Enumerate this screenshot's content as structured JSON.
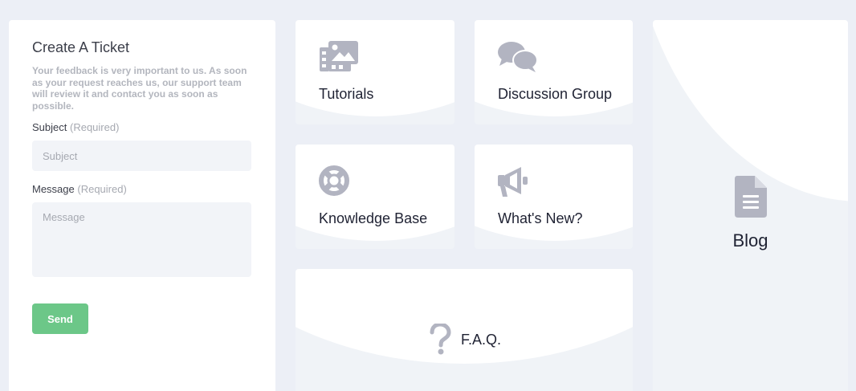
{
  "ticket": {
    "title": "Create A Ticket",
    "description": "Your feedback is very important to us. As soon as your request reaches us, our support team will review it and contact you as soon as possible.",
    "subject_label": "Subject",
    "subject_required": "(Required)",
    "subject_placeholder": "Subject",
    "subject_value": "",
    "message_label": "Message",
    "message_required": "(Required)",
    "message_placeholder": "Message",
    "message_value": "",
    "send_label": "Send"
  },
  "tiles": {
    "tutorials": {
      "label": "Tutorials",
      "icon": "tutorials-gallery-icon"
    },
    "discussion": {
      "label": "Discussion Group",
      "icon": "chat-bubbles-icon"
    },
    "knowledge": {
      "label": "Knowledge Base",
      "icon": "lifebuoy-icon"
    },
    "whatsnew": {
      "label": "What's New?",
      "icon": "megaphone-icon"
    },
    "faq": {
      "label": "F.A.Q.",
      "icon": "question-mark-icon"
    },
    "blog": {
      "label": "Blog",
      "icon": "document-icon"
    }
  },
  "colors": {
    "page_bg": "#eceff6",
    "tile_bg": "#f0f3f7",
    "icon": "#b2b4c1",
    "send_button": "#6cc788",
    "text_dark": "#1f2233"
  }
}
